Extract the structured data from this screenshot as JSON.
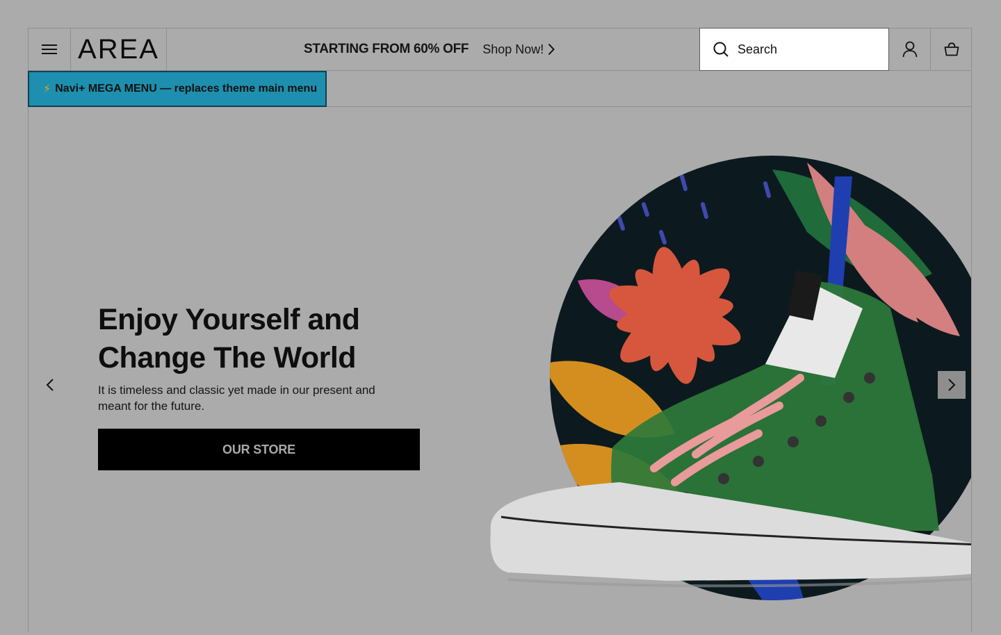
{
  "header": {
    "logo": "AREA",
    "promo_text": "STARTING FROM 60% OFF",
    "promo_link": "Shop Now!",
    "search_placeholder": "Search"
  },
  "nav": {
    "mega_menu_label": "Navi+ MEGA MENU — replaces theme main menu"
  },
  "hero": {
    "title": "Enjoy Yourself and Change The World",
    "subtitle": "It is timeless and classic yet made in our present and meant for the future.",
    "cta_label": "OUR STORE"
  },
  "icons": {
    "menu": "hamburger-icon",
    "search": "search-icon",
    "account": "user-icon",
    "cart": "cart-icon",
    "promo_arrow": "chevron-right-icon",
    "slide_prev": "chevron-left-icon",
    "slide_next": "chevron-right-icon",
    "bolt": "lightning-icon"
  },
  "colors": {
    "page_bg": "#ababab",
    "mega_menu_bg": "#1e8fae",
    "mega_menu_border": "#0f3f5a",
    "cta_bg": "#000000"
  }
}
